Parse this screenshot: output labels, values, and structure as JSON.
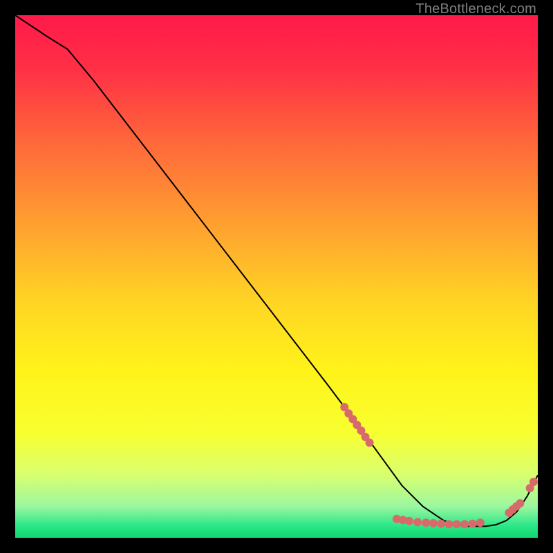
{
  "watermark": "TheBottleneck.com",
  "chart_data": {
    "type": "line",
    "title": "",
    "xlabel": "",
    "ylabel": "",
    "xlim": [
      0,
      100
    ],
    "ylim": [
      0,
      100
    ],
    "background_gradient": {
      "stops": [
        {
          "offset": 0.0,
          "color": "#ff1a4a"
        },
        {
          "offset": 0.1,
          "color": "#ff2f46"
        },
        {
          "offset": 0.25,
          "color": "#ff6a3a"
        },
        {
          "offset": 0.4,
          "color": "#ffa030"
        },
        {
          "offset": 0.55,
          "color": "#ffd524"
        },
        {
          "offset": 0.68,
          "color": "#fff31a"
        },
        {
          "offset": 0.8,
          "color": "#f8ff30"
        },
        {
          "offset": 0.88,
          "color": "#d8ff70"
        },
        {
          "offset": 0.94,
          "color": "#9cf7a0"
        },
        {
          "offset": 0.975,
          "color": "#30e88a"
        },
        {
          "offset": 1.0,
          "color": "#0fd870"
        }
      ]
    },
    "series": [
      {
        "name": "curve",
        "stroke": "#000000",
        "stroke_width": 2,
        "x": [
          0,
          3,
          6,
          10,
          15,
          20,
          25,
          30,
          35,
          40,
          45,
          50,
          55,
          60,
          63,
          66,
          70,
          74,
          78,
          82,
          86,
          90,
          92,
          94,
          96,
          98,
          100
        ],
        "values": [
          100,
          98,
          96,
          93.5,
          87.5,
          81,
          74.5,
          68,
          61.5,
          55,
          48.5,
          42,
          35.5,
          29,
          25,
          21,
          15.5,
          10,
          6,
          3.3,
          2.2,
          2.2,
          2.5,
          3.3,
          5,
          8,
          12
        ]
      }
    ],
    "markers": {
      "color": "#d86a6a",
      "radius": 6,
      "points": [
        {
          "x": 63.0,
          "y": 25.0
        },
        {
          "x": 63.8,
          "y": 23.8
        },
        {
          "x": 64.6,
          "y": 22.7
        },
        {
          "x": 65.4,
          "y": 21.6
        },
        {
          "x": 66.2,
          "y": 20.5
        },
        {
          "x": 67.0,
          "y": 19.3
        },
        {
          "x": 67.8,
          "y": 18.2
        },
        {
          "x": 73.0,
          "y": 3.6
        },
        {
          "x": 74.2,
          "y": 3.4
        },
        {
          "x": 75.4,
          "y": 3.2
        },
        {
          "x": 77.0,
          "y": 3.0
        },
        {
          "x": 78.6,
          "y": 2.9
        },
        {
          "x": 80.0,
          "y": 2.8
        },
        {
          "x": 81.5,
          "y": 2.7
        },
        {
          "x": 83.0,
          "y": 2.6
        },
        {
          "x": 84.5,
          "y": 2.6
        },
        {
          "x": 86.0,
          "y": 2.6
        },
        {
          "x": 87.5,
          "y": 2.7
        },
        {
          "x": 89.0,
          "y": 2.9
        },
        {
          "x": 94.5,
          "y": 4.8
        },
        {
          "x": 95.2,
          "y": 5.4
        },
        {
          "x": 95.9,
          "y": 6.0
        },
        {
          "x": 96.6,
          "y": 6.6
        },
        {
          "x": 98.5,
          "y": 9.5
        },
        {
          "x": 99.2,
          "y": 10.7
        }
      ]
    }
  }
}
